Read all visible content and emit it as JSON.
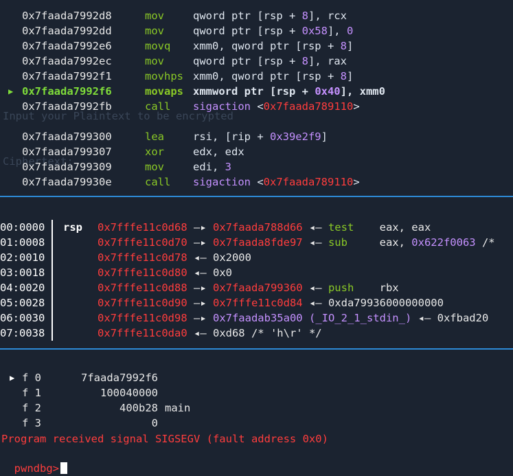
{
  "disasm": {
    "group1": [
      {
        "addr": "0x7faada7992d8",
        "mnemonic": "mov",
        "operands": [
          [
            "qword ptr [rsp + ",
            ""
          ],
          [
            "8",
            "num"
          ],
          [
            "], rcx",
            ""
          ]
        ]
      },
      {
        "addr": "0x7faada7992dd",
        "mnemonic": "mov",
        "operands": [
          [
            "qword ptr [rsp + ",
            ""
          ],
          [
            "0x58",
            "num"
          ],
          [
            "], ",
            ""
          ],
          [
            "0",
            "num"
          ]
        ]
      },
      {
        "addr": "0x7faada7992e6",
        "mnemonic": "movq",
        "operands": [
          [
            "xmm0, qword ptr [rsp + ",
            ""
          ],
          [
            "8",
            "num"
          ],
          [
            "]",
            ""
          ]
        ]
      },
      {
        "addr": "0x7faada7992ec",
        "mnemonic": "mov",
        "operands": [
          [
            "qword ptr [rsp + ",
            ""
          ],
          [
            "8",
            "num"
          ],
          [
            "], rax",
            ""
          ]
        ]
      },
      {
        "addr": "0x7faada7992f1",
        "mnemonic": "movhps",
        "operands": [
          [
            "xmm0, qword ptr [rsp + ",
            ""
          ],
          [
            "8",
            "num"
          ],
          [
            "]",
            ""
          ]
        ]
      },
      {
        "addr": "0x7faada7992f6",
        "mnemonic": "movaps",
        "current": true,
        "operands": [
          [
            "xmmword ptr [rsp + ",
            ""
          ],
          [
            "0x40",
            "num"
          ],
          [
            "], xmm0",
            ""
          ]
        ]
      },
      {
        "addr": "0x7faada7992fb",
        "mnemonic": "call",
        "operands": [
          [
            "sigaction ",
            "purple"
          ],
          [
            "<",
            ""
          ],
          [
            "0x7faada789110",
            "red"
          ],
          [
            ">",
            ""
          ]
        ]
      }
    ],
    "group2": [
      {
        "addr": "0x7faada799300",
        "mnemonic": "lea",
        "operands": [
          [
            "rsi, [rip + ",
            ""
          ],
          [
            "0x39e2f9",
            "num"
          ],
          [
            "]",
            ""
          ]
        ]
      },
      {
        "addr": "0x7faada799307",
        "mnemonic": "xor",
        "operands": [
          [
            "edx, edx",
            ""
          ]
        ]
      },
      {
        "addr": "0x7faada799309",
        "mnemonic": "mov",
        "operands": [
          [
            "edi, ",
            ""
          ],
          [
            "3",
            "num"
          ]
        ]
      },
      {
        "addr": "0x7faada79930e",
        "mnemonic": "call",
        "operands": [
          [
            "sigaction ",
            "purple"
          ],
          [
            "<",
            ""
          ],
          [
            "0x7faada789110",
            "red"
          ],
          [
            ">",
            ""
          ]
        ]
      }
    ]
  },
  "stack": [
    {
      "offset": "00:0000",
      "reg": "rsp",
      "parts": [
        [
          "0x7fffe11c0d68",
          "red"
        ],
        [
          " —▸ ",
          ""
        ],
        [
          "0x7faada788d66",
          "red"
        ],
        [
          " ◂— ",
          ""
        ],
        [
          "test",
          "green"
        ],
        [
          "    eax, eax",
          ""
        ]
      ]
    },
    {
      "offset": "01:0008",
      "reg": "",
      "parts": [
        [
          "0x7fffe11c0d70",
          "red"
        ],
        [
          " —▸ ",
          ""
        ],
        [
          "0x7faada8fde97",
          "red"
        ],
        [
          " ◂— ",
          ""
        ],
        [
          "sub",
          "green"
        ],
        [
          "     eax, ",
          ""
        ],
        [
          "0x622f0063",
          "num"
        ],
        [
          " /*",
          ""
        ]
      ]
    },
    {
      "offset": "02:0010",
      "reg": "",
      "parts": [
        [
          "0x7fffe11c0d78",
          "red"
        ],
        [
          " ◂— 0x2000",
          ""
        ]
      ]
    },
    {
      "offset": "03:0018",
      "reg": "",
      "parts": [
        [
          "0x7fffe11c0d80",
          "red"
        ],
        [
          " ◂— 0x0",
          ""
        ]
      ]
    },
    {
      "offset": "04:0020",
      "reg": "",
      "parts": [
        [
          "0x7fffe11c0d88",
          "red"
        ],
        [
          " —▸ ",
          ""
        ],
        [
          "0x7faada799360",
          "red"
        ],
        [
          " ◂— ",
          ""
        ],
        [
          "push",
          "green"
        ],
        [
          "    rbx",
          ""
        ]
      ]
    },
    {
      "offset": "05:0028",
      "reg": "",
      "parts": [
        [
          "0x7fffe11c0d90",
          "red"
        ],
        [
          " —▸ ",
          ""
        ],
        [
          "0x7fffe11c0d84",
          "red"
        ],
        [
          " ◂— 0xda79936000000000",
          ""
        ]
      ]
    },
    {
      "offset": "06:0030",
      "reg": "",
      "parts": [
        [
          "0x7fffe11c0d98",
          "red"
        ],
        [
          " —▸ ",
          ""
        ],
        [
          "0x7faadab35a00",
          "purple"
        ],
        [
          " ",
          ""
        ],
        [
          "(_IO_2_1_stdin_)",
          "purple"
        ],
        [
          " ◂— 0xfbad20",
          ""
        ]
      ]
    },
    {
      "offset": "07:0038",
      "reg": "",
      "parts": [
        [
          "0x7fffe11c0da0",
          "red"
        ],
        [
          " ◂— 0xd68 /* 'h\\r' */",
          ""
        ]
      ]
    }
  ],
  "backtrace": [
    {
      "label": "f 0",
      "addr": "7faada7992f6",
      "sym": "",
      "current": true
    },
    {
      "label": "f 1",
      "addr": "100040000",
      "sym": ""
    },
    {
      "label": "f 2",
      "addr": "400b28",
      "sym": "main"
    },
    {
      "label": "f 3",
      "addr": "0",
      "sym": ""
    }
  ],
  "signal_message": "Program received signal SIGSEGV (fault address 0x0)",
  "prompt": "pwndbg>",
  "ghost_text": {
    "line1": "Input your Plaintext to be encrypted",
    "line2": "Ciphertext:"
  },
  "colors": {
    "background": "#1b2330",
    "separator": "#2d8ad6",
    "mnemonic": "#8ac926",
    "address_red": "#ff3d3d",
    "number_purple": "#c591ff"
  }
}
